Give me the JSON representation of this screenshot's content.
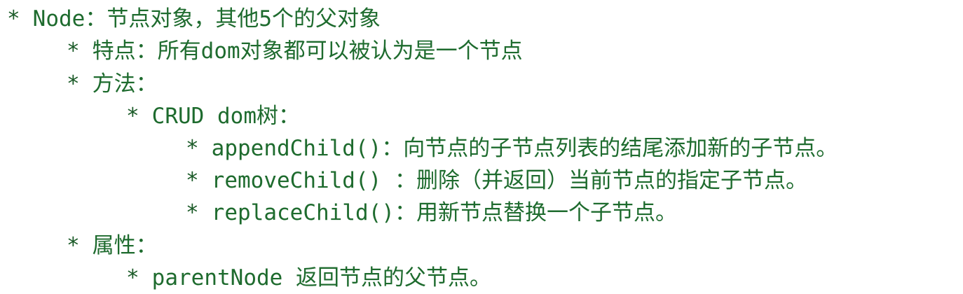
{
  "lines": [
    {
      "bullet": "*",
      "text": "Node：节点对象，其他5个的父对象"
    },
    {
      "bullet": "*",
      "text": "特点：所有dom对象都可以被认为是一个节点"
    },
    {
      "bullet": "*",
      "text": "方法："
    },
    {
      "bullet": "*",
      "text": "CRUD dom树："
    },
    {
      "bullet": "*",
      "text": "appendChild()：向节点的子节点列表的结尾添加新的子节点。"
    },
    {
      "bullet": "*",
      "text": "removeChild() ：删除（并返回）当前节点的指定子节点。"
    },
    {
      "bullet": "*",
      "text": "replaceChild()：用新节点替换一个子节点。"
    },
    {
      "bullet": "*",
      "text": "属性："
    },
    {
      "bullet": "*",
      "text": "parentNode 返回节点的父节点。"
    }
  ],
  "colors": {
    "text": "#1e6b2e",
    "background": "#ffffff"
  }
}
